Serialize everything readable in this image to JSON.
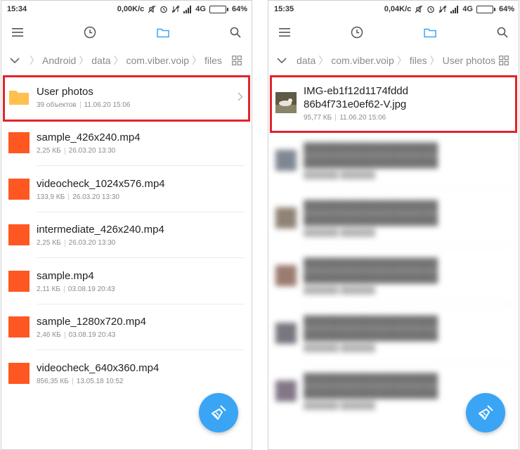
{
  "left": {
    "status": {
      "time": "15:34",
      "speed": "0,00K/c",
      "network": "4G",
      "battery": "64%",
      "battery_level": 0.64
    },
    "breadcrumb": [
      "Android",
      "data",
      "com.viber.voip",
      "files"
    ],
    "items": [
      {
        "name": "User photos",
        "meta1": "39 объектов",
        "meta2": "11.06.20 15:06"
      },
      {
        "name": "sample_426x240.mp4",
        "meta1": "2,25 КБ",
        "meta2": "26.03.20 13:30"
      },
      {
        "name": "videocheck_1024x576.mp4",
        "meta1": "133,9 КБ",
        "meta2": "26.03.20 13:30"
      },
      {
        "name": "intermediate_426x240.mp4",
        "meta1": "2,25 КБ",
        "meta2": "26.03.20 13:30"
      },
      {
        "name": "sample.mp4",
        "meta1": "2,11 КБ",
        "meta2": "03.08.19 20:43"
      },
      {
        "name": "sample_1280x720.mp4",
        "meta1": "2,46 КБ",
        "meta2": "03.08.19 20:43"
      },
      {
        "name": "videocheck_640x360.mp4",
        "meta1": "856,35 КБ",
        "meta2": "13.05.18 10:52"
      }
    ]
  },
  "right": {
    "status": {
      "time": "15:35",
      "speed": "0,04K/c",
      "network": "4G",
      "battery": "64%",
      "battery_level": 0.64
    },
    "breadcrumb": [
      "data",
      "com.viber.voip",
      "files",
      "User photos"
    ],
    "items": [
      {
        "name_line1": "IMG-eb1f12d1174fddd",
        "name_line2": "86b4f731e0ef62-V.jpg",
        "meta1": "95,77 КБ",
        "meta2": "11.06.20 15:06"
      }
    ]
  },
  "colors": {
    "file_icon": "#ff5722",
    "folder_icon": "#ffc04d",
    "fab": "#3aa5f5",
    "highlight": "#e3242b",
    "accent": "#3aa5f5"
  },
  "icons": [
    "menu-icon",
    "history-icon",
    "folder-icon",
    "search-icon",
    "chevron-down-icon",
    "grid-icon",
    "chevron-right-icon",
    "broom-icon"
  ]
}
